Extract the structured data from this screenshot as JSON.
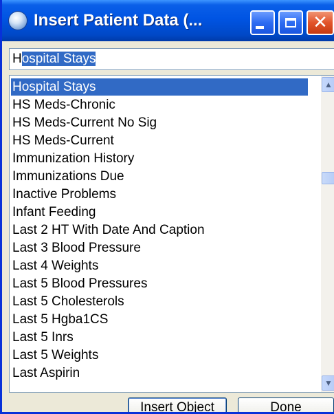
{
  "window": {
    "title": "Insert Patient Data (...",
    "buttons": {
      "minimize": "minimize-icon",
      "maximize": "maximize-icon",
      "close": "close-icon"
    }
  },
  "search": {
    "typed": "H",
    "autocomplete": "ospital Stays"
  },
  "list": {
    "items": [
      "Hospital Stays",
      "HS Meds-Chronic",
      "HS Meds-Current No Sig",
      "HS Meds-Current",
      "Immunization History",
      "Immunizations Due",
      "Inactive Problems",
      "Infant Feeding",
      "Last 2 HT With Date And Caption",
      "Last 3 Blood Pressure",
      "Last 4 Weights",
      "Last 5 Blood Pressures",
      "Last 5 Cholesterols",
      "Last 5 Hgba1CS",
      "Last 5 Inrs",
      "Last 5 Weights",
      "Last Aspirin"
    ],
    "selected_index": 0
  },
  "footer": {
    "insert_label_accel": "I",
    "insert_label_rest": "nsert Object",
    "done_label_accel": "D",
    "done_label_rest": "one"
  },
  "colors": {
    "titlebar": "#0054e3",
    "selection": "#316ac5",
    "dialog_bg": "#ece9d8"
  }
}
